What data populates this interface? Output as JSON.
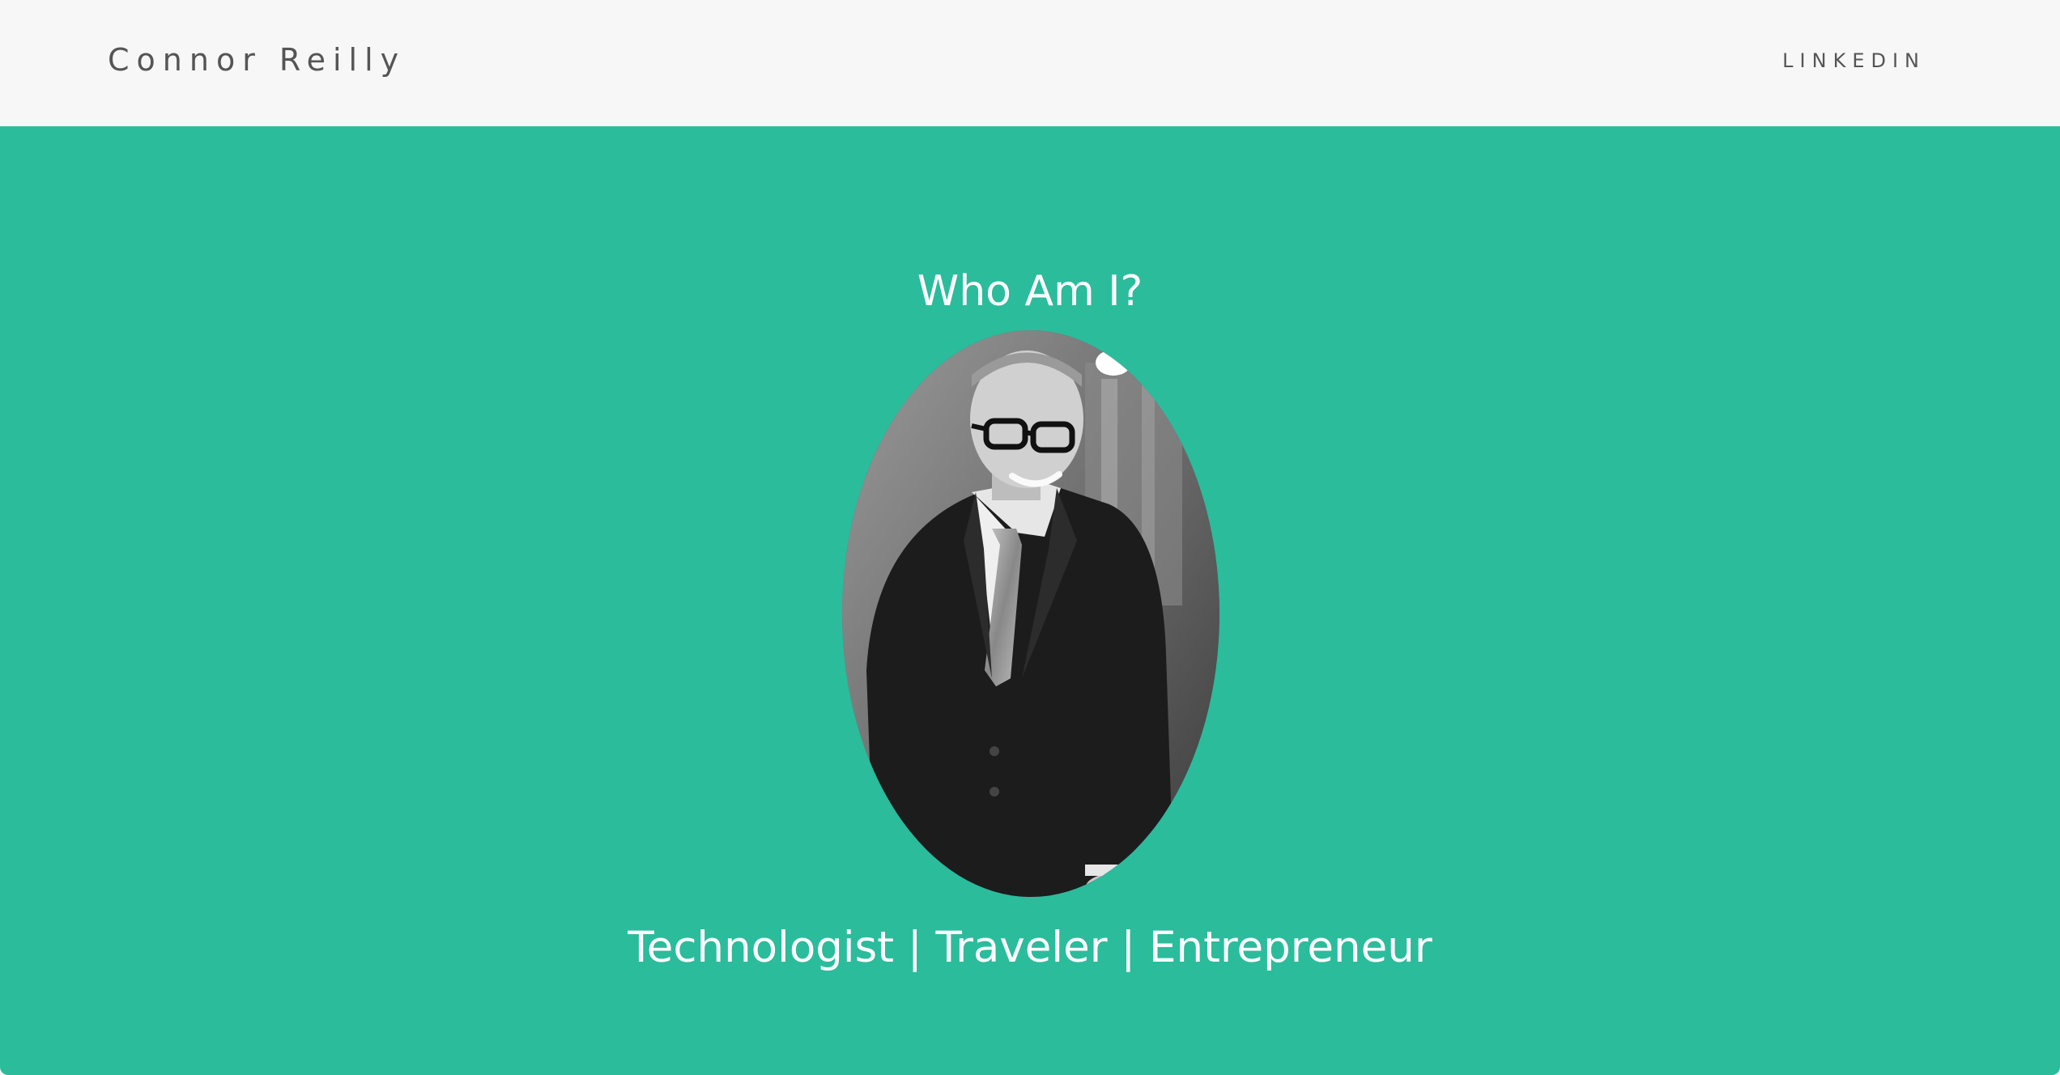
{
  "navbar": {
    "brand": "Connor Reilly",
    "links": [
      {
        "label": "LINKEDIN"
      }
    ]
  },
  "hero": {
    "title": "Who Am I?",
    "tagline": "Technologist | Traveler | Entrepreneur",
    "background_color": "#2bbc9c",
    "portrait": {
      "description_icon": "profile-photo",
      "style": "grayscale oval"
    }
  }
}
